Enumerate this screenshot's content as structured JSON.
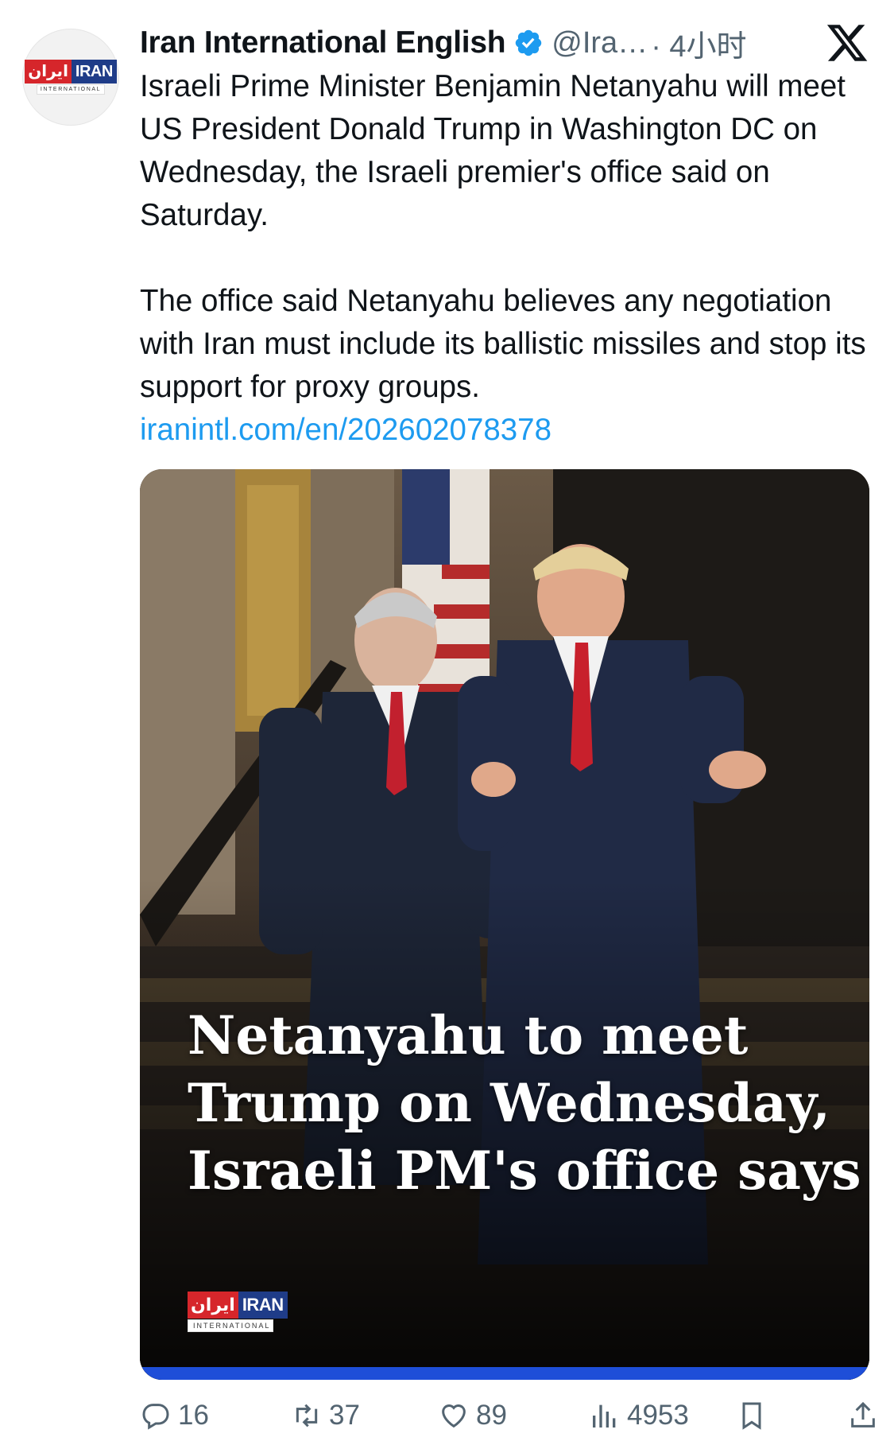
{
  "account": {
    "display_name": "Iran International English",
    "handle": "@Ira…",
    "time": "· 4小时",
    "avatar_logo": {
      "fa": "ایران",
      "en": "IRAN",
      "sub": "INTERNATIONAL"
    }
  },
  "tweet": {
    "paragraph1": "Israeli Prime Minister Benjamin Netanyahu will meet US President Donald Trump in Washington DC on Wednesday, the Israeli premier's office said on Saturday.",
    "paragraph2": "The office said Netanyahu believes any negotiation with Iran must include its ballistic missiles and stop its support for proxy groups.",
    "link": "iranintl.com/en/202602078378"
  },
  "media": {
    "headline_lines": [
      "Netanyahu to meet",
      "Trump on Wednesday,",
      "Israeli PM's office says"
    ],
    "logo": {
      "fa": "ایران",
      "en": "IRAN",
      "sub": "INTERNATIONAL"
    }
  },
  "actions": {
    "replies": "16",
    "reposts": "37",
    "likes": "89",
    "views": "4953"
  },
  "colors": {
    "text": "#0f1419",
    "secondary": "#536471",
    "link": "#1d9bf0",
    "verified": "#1d9bf0",
    "accent_bar": "#1e4ed8"
  },
  "icons": [
    "verified-badge-icon",
    "x-logo-icon",
    "reply-icon",
    "repost-icon",
    "like-icon",
    "views-icon",
    "bookmark-icon",
    "share-icon"
  ]
}
